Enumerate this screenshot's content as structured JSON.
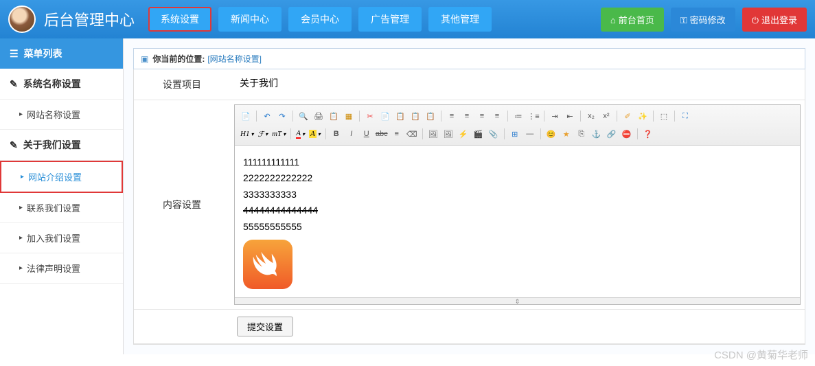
{
  "header": {
    "title": "后台管理中心",
    "nav": [
      "系统设置",
      "新闻中心",
      "会员中心",
      "广告管理",
      "其他管理"
    ],
    "right": {
      "home": "前台首页",
      "password": "密码修改",
      "logout": "退出登录"
    }
  },
  "sidebar": {
    "title": "菜单列表",
    "groups": [
      {
        "label": "系统名称设置",
        "items": [
          "网站名称设置"
        ]
      },
      {
        "label": "关于我们设置",
        "items": [
          "网站介绍设置",
          "联系我们设置",
          "加入我们设置",
          "法律声明设置"
        ]
      }
    ]
  },
  "breadcrumb": {
    "prefix": "你当前的位置:",
    "location": "[网站名称设置]"
  },
  "form": {
    "projectLabel": "设置项目",
    "projectValue": "关于我们",
    "contentLabel": "内容设置",
    "editorContent": {
      "line1": "111111111111",
      "line2": "2222222222222",
      "line3": "3333333333",
      "line4": "44444444444444",
      "line5": "55555555555"
    },
    "submit": "提交设置"
  },
  "toolbar": {
    "h1": "H1",
    "font": "ℱ",
    "tt": "тT",
    "a": "A",
    "aHi": "A",
    "b": "B",
    "i": "I",
    "u": "U"
  },
  "watermark": "CSDN @黄菊华老师"
}
